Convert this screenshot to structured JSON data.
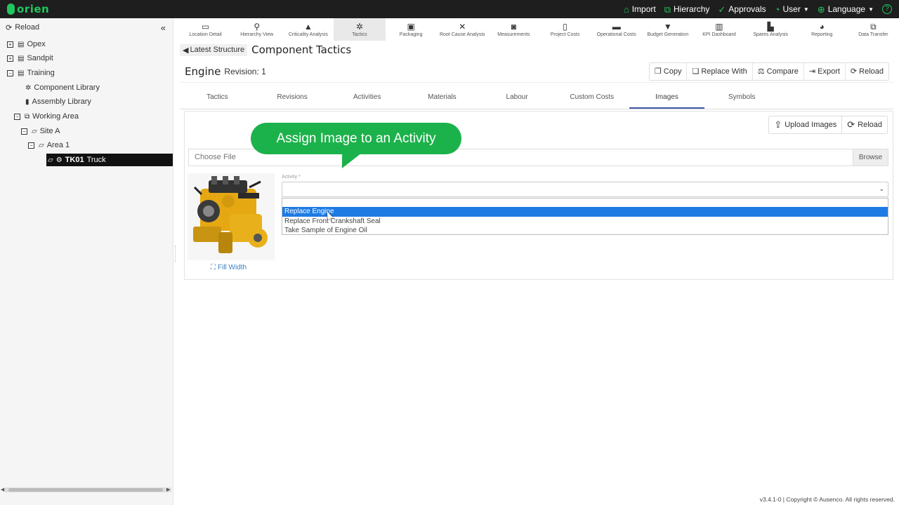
{
  "app": {
    "logo_text": "orien",
    "brand_color": "#22c55e"
  },
  "top_nav": [
    {
      "label": "Import",
      "icon": "lightbulb-icon",
      "glyph": "⌂"
    },
    {
      "label": "Hierarchy",
      "icon": "sitemap-icon",
      "glyph": "⧉"
    },
    {
      "label": "Approvals",
      "icon": "check-circle-icon",
      "glyph": "✓"
    },
    {
      "label": "User",
      "icon": "user-icon",
      "glyph": "◔"
    },
    {
      "label": "Language",
      "icon": "globe-icon",
      "glyph": "⊕"
    }
  ],
  "help_glyph": "?",
  "sidebar": {
    "reload_label": "Reload",
    "collapse_glyph": "«",
    "tree": [
      {
        "label": "Opex",
        "toggle": "+",
        "icon": "database-icon",
        "glyph": "▤"
      },
      {
        "label": "Sandpit",
        "toggle": "+",
        "icon": "database-icon",
        "glyph": "▤"
      },
      {
        "label": "Training",
        "toggle": "−",
        "icon": "database-icon",
        "glyph": "▤"
      },
      {
        "label": "Component Library",
        "icon": "gear-icon",
        "glyph": "✲"
      },
      {
        "label": "Assembly Library",
        "icon": "book-icon",
        "glyph": "▮"
      },
      {
        "label": "Working Area",
        "toggle": "−",
        "icon": "sitemap-icon",
        "glyph": "⧉"
      },
      {
        "label": "Site A",
        "toggle": "−",
        "icon": "folder-open-icon",
        "glyph": "▱"
      },
      {
        "label": "Area 1",
        "toggle": "−",
        "icon": "folder-open-icon",
        "glyph": "▱"
      },
      {
        "label_bold": "TK01",
        "label": "Truck",
        "icon": "cogs-icon",
        "glyph": "⚙",
        "selected": true
      }
    ]
  },
  "modules": [
    {
      "label": "Location Detail",
      "icon": "folder-icon",
      "glyph": "▭"
    },
    {
      "label": "Hierarchy View",
      "icon": "search-icon",
      "glyph": "⚲"
    },
    {
      "label": "Criticality Analysis",
      "icon": "warning-icon",
      "glyph": "▲"
    },
    {
      "label": "Tactics",
      "icon": "gear-icon",
      "glyph": "✲",
      "active": true
    },
    {
      "label": "Packaging",
      "icon": "image-icon",
      "glyph": "▣"
    },
    {
      "label": "Root Cause Analysis",
      "icon": "tools-icon",
      "glyph": "✕"
    },
    {
      "label": "Measurements",
      "icon": "camera-icon",
      "glyph": "◙"
    },
    {
      "label": "Project Costs",
      "icon": "file-invoice-icon",
      "glyph": "▯"
    },
    {
      "label": "Operational Costs",
      "icon": "credit-card-icon",
      "glyph": "▬"
    },
    {
      "label": "Budget Generation",
      "icon": "filter-dollar-icon",
      "glyph": "▼"
    },
    {
      "label": "KPI Dashboard",
      "icon": "bar-chart-icon",
      "glyph": "▥"
    },
    {
      "label": "Spares Analysis",
      "icon": "chart-line-icon",
      "glyph": "▙"
    },
    {
      "label": "Reporting",
      "icon": "pie-chart-icon",
      "glyph": "◕"
    },
    {
      "label": "Data Transfer",
      "icon": "external-link-icon",
      "glyph": "⧉"
    }
  ],
  "header": {
    "back_label": "Latest Structure",
    "title": "Component Tactics",
    "component_name": "Engine",
    "revision": "Revision: 1"
  },
  "actions": [
    {
      "label": "Copy",
      "icon": "copy-icon",
      "glyph": "❐"
    },
    {
      "label": "Replace With",
      "icon": "clone-icon",
      "glyph": "❏"
    },
    {
      "label": "Compare",
      "icon": "balance-scale-icon",
      "glyph": "⚖"
    },
    {
      "label": "Export",
      "icon": "file-export-icon",
      "glyph": "⇥"
    },
    {
      "label": "Reload",
      "icon": "sync-icon",
      "glyph": "⟳"
    }
  ],
  "tabs": [
    "Tactics",
    "Revisions",
    "Activities",
    "Materials",
    "Labour",
    "Custom Costs",
    "Images",
    "Symbols"
  ],
  "active_tab": "Images",
  "images_panel": {
    "upload_label": "Upload Images",
    "reload_label": "Reload",
    "file_placeholder": "Choose File",
    "browse_label": "Browse",
    "fill_width_label": "Fill Width",
    "activity_label": "Activity *",
    "activity_options": [
      "Replace Engine",
      "Replace Front Crankshaft Seal",
      "Take Sample of Engine Oil"
    ],
    "highlighted_option": "Replace Engine"
  },
  "callout": {
    "text": "Assign Image to an Activity",
    "color": "#1cb24b"
  },
  "footer": "v3.4.1-0 | Copyright © Ausenco. All rights reserved."
}
